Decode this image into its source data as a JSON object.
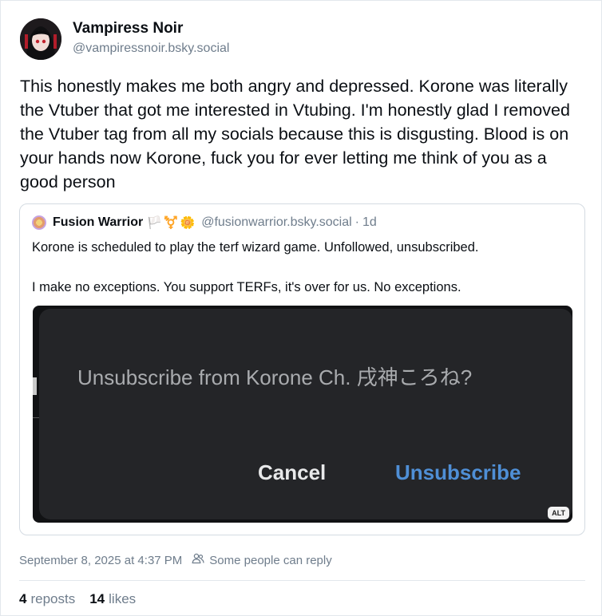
{
  "author": {
    "name": "Vampiress Noir",
    "handle": "@vampiressnoir.bsky.social"
  },
  "post": {
    "text": "This honestly makes me both angry and depressed. Korone was literally the Vtuber that got me interested in Vtubing. I'm honestly glad I removed the Vtuber tag from all my socials because this is disgusting. Blood is on your hands now Korone, fuck you for ever letting me think of you as a good person"
  },
  "quote": {
    "name": "Fusion Warrior",
    "name_emoji": "🏳️⚧️🌼",
    "handle": "@fusionwarrior.bsky.social",
    "separator": "·",
    "time": "1d",
    "paragraph1": "Korone is scheduled to play the terf wizard game. Unfollowed, unsubscribed.",
    "paragraph2": "I make no exceptions. You support TERFs, it's over for us. No exceptions.",
    "image": {
      "dialog_text": "Unsubscribe from Korone Ch. 戌神ころね?",
      "cancel_label": "Cancel",
      "unsubscribe_label": "Unsubscribe",
      "alt_badge": "ALT"
    }
  },
  "meta": {
    "timestamp": "September 8, 2025 at 4:37 PM",
    "reply_setting": "Some people can reply",
    "reply_icon": "people-icon"
  },
  "stats": {
    "reposts_count": "4",
    "reposts_label": "reposts",
    "likes_count": "14",
    "likes_label": "likes"
  }
}
